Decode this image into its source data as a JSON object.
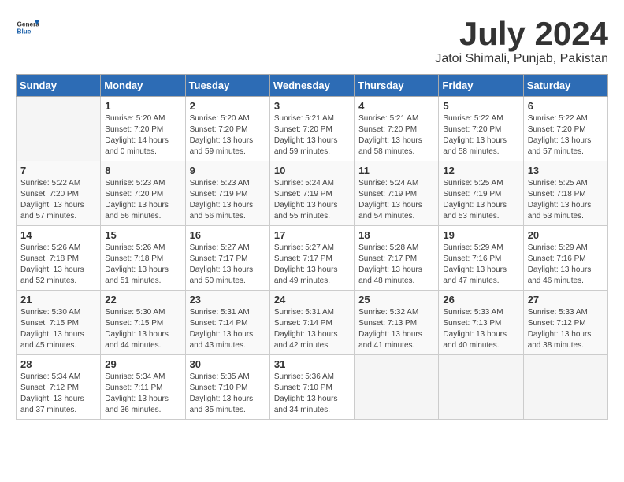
{
  "header": {
    "logo_general": "General",
    "logo_blue": "Blue",
    "month": "July 2024",
    "location": "Jatoi Shimali, Punjab, Pakistan"
  },
  "weekdays": [
    "Sunday",
    "Monday",
    "Tuesday",
    "Wednesday",
    "Thursday",
    "Friday",
    "Saturday"
  ],
  "weeks": [
    [
      {
        "day": "",
        "sunrise": "",
        "sunset": "",
        "daylight": ""
      },
      {
        "day": "1",
        "sunrise": "Sunrise: 5:20 AM",
        "sunset": "Sunset: 7:20 PM",
        "daylight": "Daylight: 14 hours and 0 minutes."
      },
      {
        "day": "2",
        "sunrise": "Sunrise: 5:20 AM",
        "sunset": "Sunset: 7:20 PM",
        "daylight": "Daylight: 13 hours and 59 minutes."
      },
      {
        "day": "3",
        "sunrise": "Sunrise: 5:21 AM",
        "sunset": "Sunset: 7:20 PM",
        "daylight": "Daylight: 13 hours and 59 minutes."
      },
      {
        "day": "4",
        "sunrise": "Sunrise: 5:21 AM",
        "sunset": "Sunset: 7:20 PM",
        "daylight": "Daylight: 13 hours and 58 minutes."
      },
      {
        "day": "5",
        "sunrise": "Sunrise: 5:22 AM",
        "sunset": "Sunset: 7:20 PM",
        "daylight": "Daylight: 13 hours and 58 minutes."
      },
      {
        "day": "6",
        "sunrise": "Sunrise: 5:22 AM",
        "sunset": "Sunset: 7:20 PM",
        "daylight": "Daylight: 13 hours and 57 minutes."
      }
    ],
    [
      {
        "day": "7",
        "sunrise": "Sunrise: 5:22 AM",
        "sunset": "Sunset: 7:20 PM",
        "daylight": "Daylight: 13 hours and 57 minutes."
      },
      {
        "day": "8",
        "sunrise": "Sunrise: 5:23 AM",
        "sunset": "Sunset: 7:20 PM",
        "daylight": "Daylight: 13 hours and 56 minutes."
      },
      {
        "day": "9",
        "sunrise": "Sunrise: 5:23 AM",
        "sunset": "Sunset: 7:19 PM",
        "daylight": "Daylight: 13 hours and 56 minutes."
      },
      {
        "day": "10",
        "sunrise": "Sunrise: 5:24 AM",
        "sunset": "Sunset: 7:19 PM",
        "daylight": "Daylight: 13 hours and 55 minutes."
      },
      {
        "day": "11",
        "sunrise": "Sunrise: 5:24 AM",
        "sunset": "Sunset: 7:19 PM",
        "daylight": "Daylight: 13 hours and 54 minutes."
      },
      {
        "day": "12",
        "sunrise": "Sunrise: 5:25 AM",
        "sunset": "Sunset: 7:19 PM",
        "daylight": "Daylight: 13 hours and 53 minutes."
      },
      {
        "day": "13",
        "sunrise": "Sunrise: 5:25 AM",
        "sunset": "Sunset: 7:18 PM",
        "daylight": "Daylight: 13 hours and 53 minutes."
      }
    ],
    [
      {
        "day": "14",
        "sunrise": "Sunrise: 5:26 AM",
        "sunset": "Sunset: 7:18 PM",
        "daylight": "Daylight: 13 hours and 52 minutes."
      },
      {
        "day": "15",
        "sunrise": "Sunrise: 5:26 AM",
        "sunset": "Sunset: 7:18 PM",
        "daylight": "Daylight: 13 hours and 51 minutes."
      },
      {
        "day": "16",
        "sunrise": "Sunrise: 5:27 AM",
        "sunset": "Sunset: 7:17 PM",
        "daylight": "Daylight: 13 hours and 50 minutes."
      },
      {
        "day": "17",
        "sunrise": "Sunrise: 5:27 AM",
        "sunset": "Sunset: 7:17 PM",
        "daylight": "Daylight: 13 hours and 49 minutes."
      },
      {
        "day": "18",
        "sunrise": "Sunrise: 5:28 AM",
        "sunset": "Sunset: 7:17 PM",
        "daylight": "Daylight: 13 hours and 48 minutes."
      },
      {
        "day": "19",
        "sunrise": "Sunrise: 5:29 AM",
        "sunset": "Sunset: 7:16 PM",
        "daylight": "Daylight: 13 hours and 47 minutes."
      },
      {
        "day": "20",
        "sunrise": "Sunrise: 5:29 AM",
        "sunset": "Sunset: 7:16 PM",
        "daylight": "Daylight: 13 hours and 46 minutes."
      }
    ],
    [
      {
        "day": "21",
        "sunrise": "Sunrise: 5:30 AM",
        "sunset": "Sunset: 7:15 PM",
        "daylight": "Daylight: 13 hours and 45 minutes."
      },
      {
        "day": "22",
        "sunrise": "Sunrise: 5:30 AM",
        "sunset": "Sunset: 7:15 PM",
        "daylight": "Daylight: 13 hours and 44 minutes."
      },
      {
        "day": "23",
        "sunrise": "Sunrise: 5:31 AM",
        "sunset": "Sunset: 7:14 PM",
        "daylight": "Daylight: 13 hours and 43 minutes."
      },
      {
        "day": "24",
        "sunrise": "Sunrise: 5:31 AM",
        "sunset": "Sunset: 7:14 PM",
        "daylight": "Daylight: 13 hours and 42 minutes."
      },
      {
        "day": "25",
        "sunrise": "Sunrise: 5:32 AM",
        "sunset": "Sunset: 7:13 PM",
        "daylight": "Daylight: 13 hours and 41 minutes."
      },
      {
        "day": "26",
        "sunrise": "Sunrise: 5:33 AM",
        "sunset": "Sunset: 7:13 PM",
        "daylight": "Daylight: 13 hours and 40 minutes."
      },
      {
        "day": "27",
        "sunrise": "Sunrise: 5:33 AM",
        "sunset": "Sunset: 7:12 PM",
        "daylight": "Daylight: 13 hours and 38 minutes."
      }
    ],
    [
      {
        "day": "28",
        "sunrise": "Sunrise: 5:34 AM",
        "sunset": "Sunset: 7:12 PM",
        "daylight": "Daylight: 13 hours and 37 minutes."
      },
      {
        "day": "29",
        "sunrise": "Sunrise: 5:34 AM",
        "sunset": "Sunset: 7:11 PM",
        "daylight": "Daylight: 13 hours and 36 minutes."
      },
      {
        "day": "30",
        "sunrise": "Sunrise: 5:35 AM",
        "sunset": "Sunset: 7:10 PM",
        "daylight": "Daylight: 13 hours and 35 minutes."
      },
      {
        "day": "31",
        "sunrise": "Sunrise: 5:36 AM",
        "sunset": "Sunset: 7:10 PM",
        "daylight": "Daylight: 13 hours and 34 minutes."
      },
      {
        "day": "",
        "sunrise": "",
        "sunset": "",
        "daylight": ""
      },
      {
        "day": "",
        "sunrise": "",
        "sunset": "",
        "daylight": ""
      },
      {
        "day": "",
        "sunrise": "",
        "sunset": "",
        "daylight": ""
      }
    ]
  ]
}
